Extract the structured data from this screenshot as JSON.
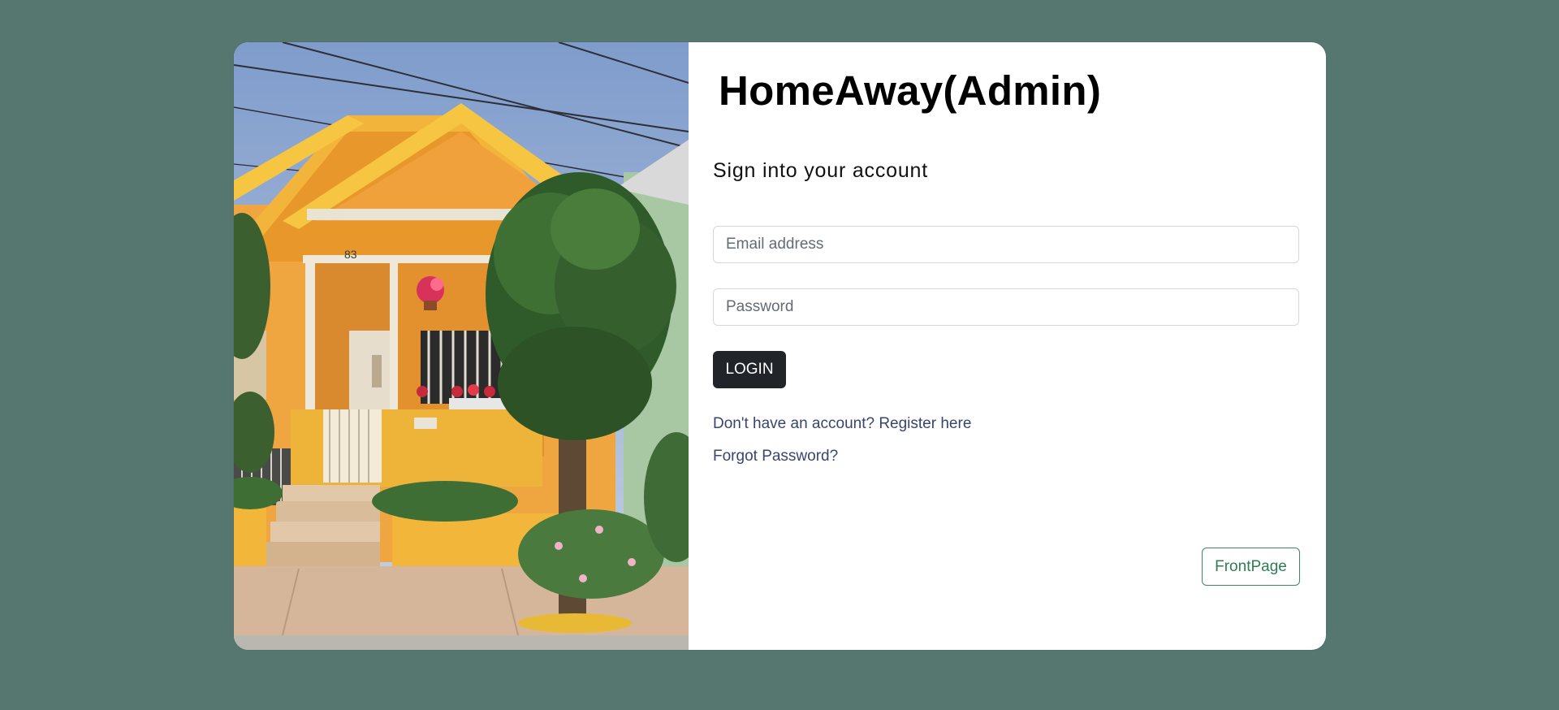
{
  "app": {
    "title": "HomeAway(Admin)"
  },
  "form": {
    "heading": "Sign into your account",
    "email_placeholder": "Email address",
    "password_placeholder": "Password",
    "login_label": "LOGIN",
    "register_text": "Don't have an account? Register here",
    "forgot_text": "Forgot Password?"
  },
  "footer": {
    "frontpage_label": "FrontPage"
  },
  "image": {
    "house_number": "83"
  },
  "colors": {
    "page_background": "#557770",
    "card_background": "#ffffff",
    "login_button": "#212529",
    "link": "#39456e",
    "frontpage_accent": "#2f7d54"
  },
  "icons": {
    "photo": "house-photo"
  }
}
